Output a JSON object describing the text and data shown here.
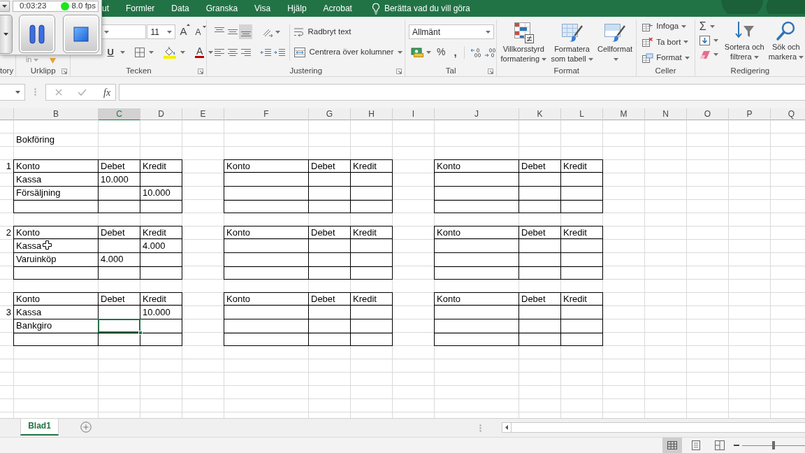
{
  "recorder": {
    "elapsed": "0:03:23",
    "fps": "8.0 fps"
  },
  "ribbon": {
    "tabs": [
      {
        "label": "ut",
        "selected": false
      },
      {
        "label": "Formler",
        "selected": false
      },
      {
        "label": "Data",
        "selected": false
      },
      {
        "label": "Granska",
        "selected": false
      },
      {
        "label": "Visa",
        "selected": false
      },
      {
        "label": "Hjälp",
        "selected": false
      },
      {
        "label": "Acrobat",
        "selected": false
      }
    ],
    "tell_me": "Berätta vad du vill göra",
    "groups": [
      {
        "label": "tory"
      },
      {
        "label": "Urklipp",
        "paste": "in"
      },
      {
        "label": "Tecken",
        "font_size": "11",
        "grow_font": "A",
        "shrink_font": "A",
        "underline": "U",
        "font_color": "A"
      },
      {
        "label": "Justering",
        "vertical_align": [
          {
            "selected": false
          },
          {
            "selected": false
          },
          {
            "selected": true
          }
        ],
        "wrap_text": "Radbryt text",
        "merge": "Centrera över kolumner"
      },
      {
        "label": "Tal",
        "number_format": "Allmänt",
        "percent": "%",
        "comma": ","
      },
      {
        "label": "Format",
        "buttons": [
          {
            "lines": [
              "Villkorsstyrd",
              "formatering"
            ]
          },
          {
            "lines": [
              "Formatera",
              "som tabell"
            ]
          },
          {
            "lines": [
              "Cellformat"
            ]
          }
        ]
      },
      {
        "label": "Celler",
        "buttons": [
          "Infoga",
          "Ta bort",
          "Format"
        ]
      },
      {
        "label": "Redigering",
        "autosum": "Σ",
        "buttons": [
          {
            "lines": [
              "Sortera och",
              "filtrera"
            ]
          },
          {
            "lines": [
              "Sök och",
              "markera"
            ]
          }
        ]
      }
    ]
  },
  "formula_bar": {
    "function_label": "fx"
  },
  "sheet": {
    "columns": [
      {
        "label": "B",
        "selected": false
      },
      {
        "label": "C",
        "selected": true
      },
      {
        "label": "D",
        "selected": false
      },
      {
        "label": "E",
        "selected": false
      },
      {
        "label": "F",
        "selected": false
      },
      {
        "label": "G",
        "selected": false
      },
      {
        "label": "H",
        "selected": false
      },
      {
        "label": "I",
        "selected": false
      },
      {
        "label": "J",
        "selected": false
      },
      {
        "label": "K",
        "selected": false
      },
      {
        "label": "L",
        "selected": false
      },
      {
        "label": "M",
        "selected": false
      },
      {
        "label": "N",
        "selected": false
      },
      {
        "label": "O",
        "selected": false
      },
      {
        "label": "P",
        "selected": false
      },
      {
        "label": "Q",
        "selected": false
      }
    ],
    "title": "Bokföring",
    "ledgers": [
      {
        "tables": [
          {
            "rows": [
              {
                "number": "1",
                "account": "Konto",
                "debit": "Debet",
                "credit": "Kredit",
                "selected": false
              },
              {
                "account": "Kassa",
                "debit": "10.000",
                "selected": false
              },
              {
                "account": "Försäljning",
                "credit": "10.000",
                "selected": false
              }
            ]
          },
          {
            "rows": [
              {
                "account": "Konto",
                "debit": "Debet",
                "credit": "Kredit",
                "selected": false
              }
            ]
          },
          {
            "rows": [
              {
                "account": "Konto",
                "debit": "Debet",
                "credit": "Kredit",
                "selected": false
              }
            ]
          }
        ]
      },
      {
        "tables": [
          {
            "rows": [
              {
                "number": "2",
                "account": "Konto",
                "debit": "Debet",
                "credit": "Kredit",
                "selected": false
              },
              {
                "account": "Kassa",
                "credit": "4.000",
                "selected": false
              },
              {
                "account": "Varuinköp",
                "debit": "4.000",
                "selected": false
              }
            ]
          },
          {
            "rows": [
              {
                "account": "Konto",
                "debit": "Debet",
                "credit": "Kredit",
                "selected": false
              }
            ]
          },
          {
            "rows": [
              {
                "account": "Konto",
                "debit": "Debet",
                "credit": "Kredit",
                "selected": false
              }
            ]
          }
        ]
      },
      {
        "tables": [
          {
            "rows": [
              {
                "account": "Konto",
                "debit": "Debet",
                "credit": "Kredit",
                "selected": false
              },
              {
                "number": "3",
                "account": "Kassa",
                "credit": "10.000",
                "selected": false
              },
              {
                "account": "Bankgiro",
                "selected": true
              }
            ]
          },
          {
            "rows": [
              {
                "account": "Konto",
                "debit": "Debet",
                "credit": "Kredit",
                "selected": false
              }
            ]
          },
          {
            "rows": [
              {
                "account": "Konto",
                "debit": "Debet",
                "credit": "Kredit",
                "selected": false
              }
            ]
          }
        ]
      }
    ]
  },
  "sheet_tabs": [
    {
      "label": "Blad1",
      "selected": true
    }
  ],
  "status_bar": {
    "views": [
      {
        "selected": true
      },
      {
        "selected": false
      },
      {
        "selected": false
      }
    ],
    "zoom": {
      "level": 0.5
    }
  }
}
